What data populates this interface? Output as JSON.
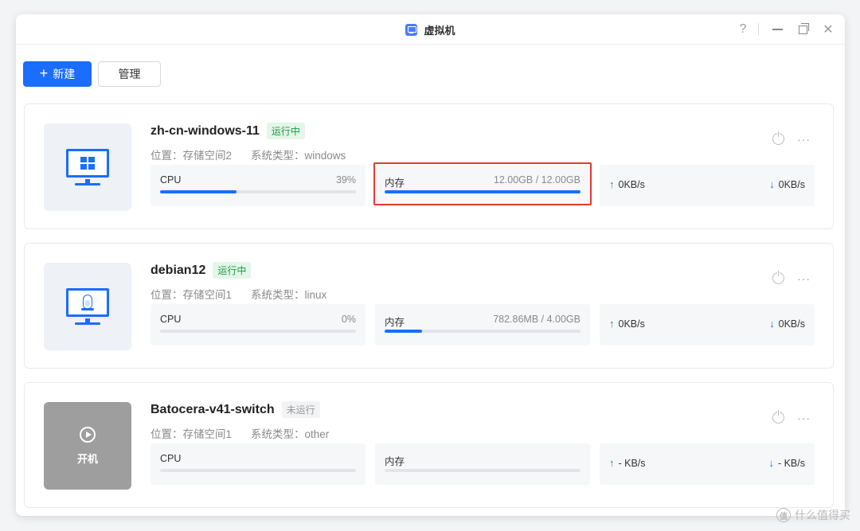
{
  "window": {
    "title": "虚拟机",
    "help": "?"
  },
  "toolbar": {
    "new_label": "新建",
    "new_icon": "+",
    "manage_label": "管理"
  },
  "vms": [
    {
      "name": "zh-cn-windows-11",
      "status": "运行中",
      "location": "位置：存储空间2",
      "os_type": "系统类型：windows",
      "cpu_label": "CPU",
      "cpu_value": "39%",
      "cpu_percent": 39,
      "mem_label": "内存",
      "mem_value": "12.00GB / 12.00GB",
      "mem_percent": 100,
      "net_up": "0KB/s",
      "net_down": "0KB/s",
      "icon": "windows-logo-icon"
    },
    {
      "name": "debian12",
      "status": "运行中",
      "location": "位置：存储空间1",
      "os_type": "系统类型：linux",
      "cpu_label": "CPU",
      "cpu_value": "0%",
      "cpu_percent": 0,
      "mem_label": "内存",
      "mem_value": "782.86MB / 4.00GB",
      "mem_percent": 19,
      "net_up": "0KB/s",
      "net_down": "0KB/s",
      "icon": "linux-tux-icon"
    },
    {
      "name": "Batocera-v41-switch",
      "status": "未运行",
      "location": "位置：存储空间1",
      "os_type": "系统类型：other",
      "cpu_label": "CPU",
      "cpu_value": "",
      "cpu_percent": 0,
      "mem_label": "内存",
      "mem_value": "",
      "mem_percent": 0,
      "net_up": "- KB/s",
      "net_down": "- KB/s",
      "start_label": "开机",
      "icon": "play-icon"
    }
  ],
  "watermark": {
    "text": "什么值得买",
    "logo": "值"
  },
  "colors": {
    "accent": "#1a6dff",
    "running": "#1d9b47",
    "highlight": "#e53935"
  }
}
